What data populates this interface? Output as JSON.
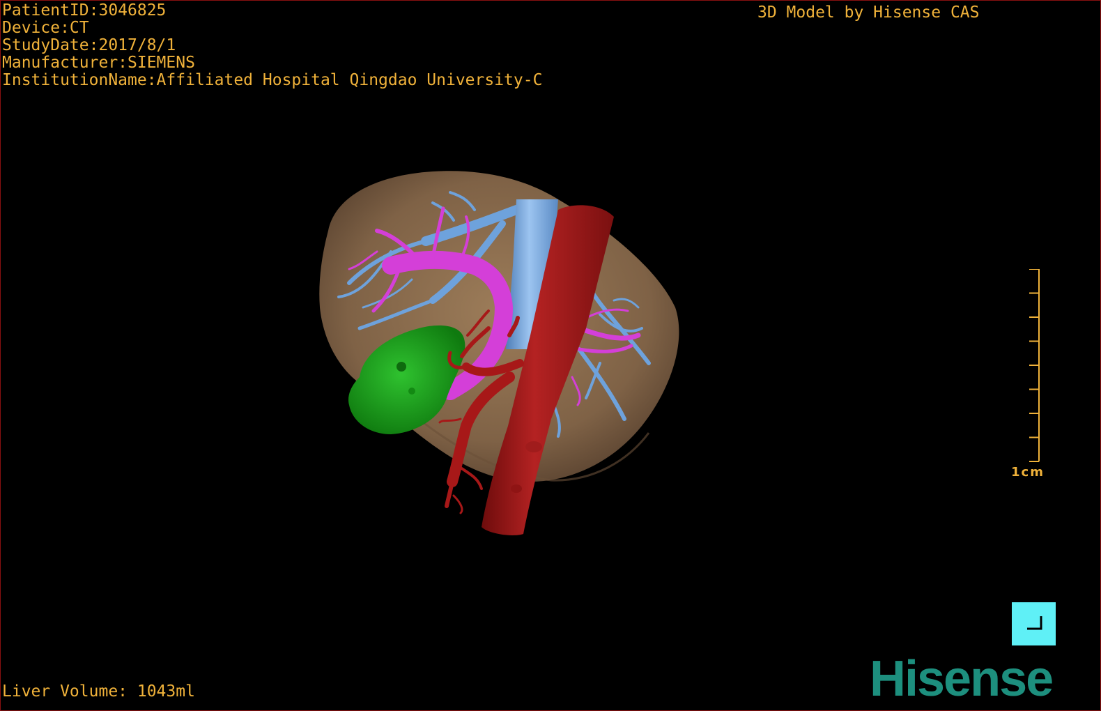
{
  "patient_info": {
    "patient_id": "PatientID:3046825",
    "device": "Device:CT",
    "study_date": "StudyDate:2017/8/1",
    "manufacturer": "Manufacturer:SIEMENS",
    "institution": "InstitutionName:Affiliated Hospital Qingdao University-C"
  },
  "model_label": "3D Model by Hisense CAS",
  "liver_volume": "Liver Volume: 1043ml",
  "scale_bar": {
    "label": "1cm",
    "ticks": 9
  },
  "reset_view_icon": "corner-bracket-icon",
  "brand": "Hisense",
  "colors": {
    "overlay_text": "#f0b23a",
    "liver": "#8a6b4c",
    "hepatic_vein": "#6ea2dc",
    "portal_vein": "#d43fd8",
    "artery": "#a71818",
    "tumor": "#1aa51a",
    "button": "#5ff0f6",
    "brand": "#1d8f7e"
  }
}
